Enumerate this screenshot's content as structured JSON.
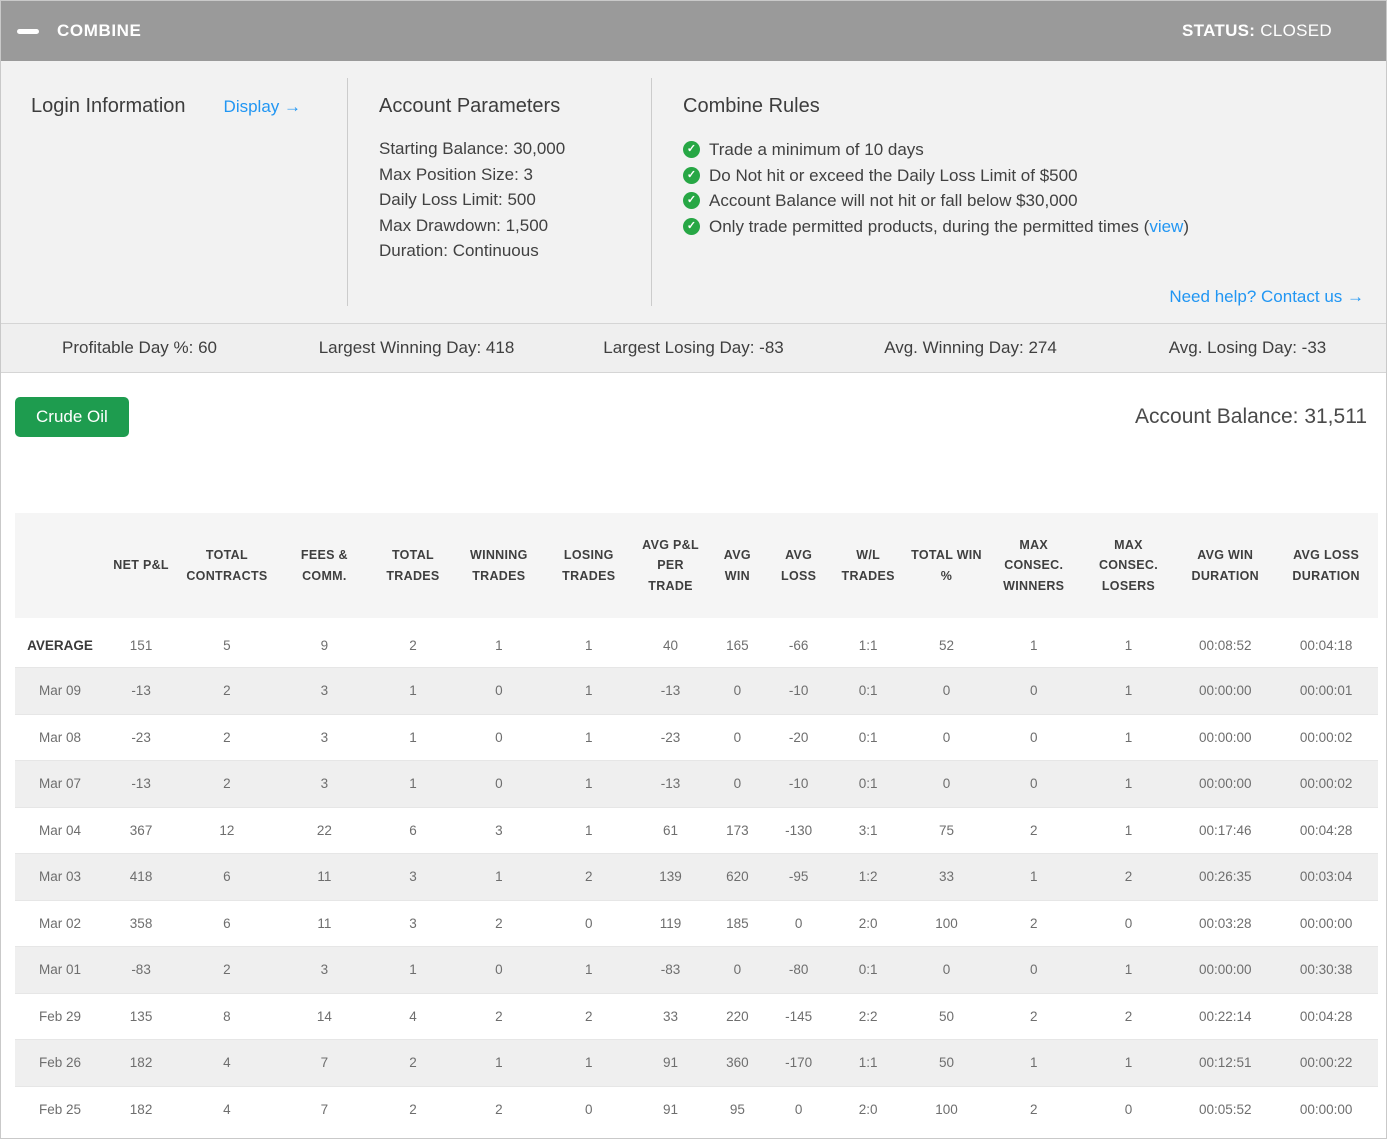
{
  "header": {
    "title": "COMBINE",
    "status_label": "STATUS:",
    "status_value": " CLOSED"
  },
  "login": {
    "title": "Login Information",
    "display_link": "Display →"
  },
  "account_parameters": {
    "title": "Account Parameters",
    "items": [
      "Starting Balance: 30,000",
      "Max Position Size: 3",
      "Daily Loss Limit: 500",
      "Max Drawdown: 1,500",
      "Duration: Continuous"
    ]
  },
  "combine_rules": {
    "title": "Combine Rules",
    "rules": [
      {
        "text": "Trade a minimum of 10 days"
      },
      {
        "text": "Do Not hit or exceed the Daily Loss Limit of $500"
      },
      {
        "text": "Account Balance will not hit or fall below $30,000"
      },
      {
        "text": "Only trade permitted products, during the permitted times (",
        "link": "view",
        "suffix": ")"
      }
    ]
  },
  "help_link": "Need help? Contact us →",
  "stats": [
    "Profitable Day %: 60",
    "Largest Winning Day: 418",
    "Largest Losing Day: -83",
    "Avg. Winning Day: 274",
    "Avg. Losing Day: -33"
  ],
  "instrument_button": "Crude Oil",
  "account_balance": {
    "label": "Account Balance: ",
    "value": "31,511"
  },
  "colors": {
    "header_gray": "#9a9a9a",
    "link_blue": "#2196f3",
    "check_green": "#27a745",
    "button_green": "#1e9c4f"
  },
  "table": {
    "columns": [
      "",
      "NET P&L",
      "TOTAL CONTRACTS",
      "FEES & COMM.",
      "TOTAL TRADES",
      "WINNING TRADES",
      "LOSING TRADES",
      "AVG P&L PER TRADE",
      "AVG WIN",
      "AVG LOSS",
      "W/L TRADES",
      "TOTAL WIN %",
      "MAX CONSEC. WINNERS",
      "MAX CONSEC. LOSERS",
      "AVG WIN DURATION",
      "AVG LOSS DURATION"
    ],
    "rows": [
      {
        "label": "AVERAGE",
        "bold": true,
        "values": [
          "151",
          "5",
          "9",
          "2",
          "1",
          "1",
          "40",
          "165",
          "-66",
          "1:1",
          "52",
          "1",
          "1",
          "00:08:52",
          "00:04:18"
        ]
      },
      {
        "label": "Mar 09",
        "values": [
          "-13",
          "2",
          "3",
          "1",
          "0",
          "1",
          "-13",
          "0",
          "-10",
          "0:1",
          "0",
          "0",
          "1",
          "00:00:00",
          "00:00:01"
        ]
      },
      {
        "label": "Mar 08",
        "values": [
          "-23",
          "2",
          "3",
          "1",
          "0",
          "1",
          "-23",
          "0",
          "-20",
          "0:1",
          "0",
          "0",
          "1",
          "00:00:00",
          "00:00:02"
        ]
      },
      {
        "label": "Mar 07",
        "values": [
          "-13",
          "2",
          "3",
          "1",
          "0",
          "1",
          "-13",
          "0",
          "-10",
          "0:1",
          "0",
          "0",
          "1",
          "00:00:00",
          "00:00:02"
        ]
      },
      {
        "label": "Mar 04",
        "values": [
          "367",
          "12",
          "22",
          "6",
          "3",
          "1",
          "61",
          "173",
          "-130",
          "3:1",
          "75",
          "2",
          "1",
          "00:17:46",
          "00:04:28"
        ]
      },
      {
        "label": "Mar 03",
        "values": [
          "418",
          "6",
          "11",
          "3",
          "1",
          "2",
          "139",
          "620",
          "-95",
          "1:2",
          "33",
          "1",
          "2",
          "00:26:35",
          "00:03:04"
        ]
      },
      {
        "label": "Mar 02",
        "values": [
          "358",
          "6",
          "11",
          "3",
          "2",
          "0",
          "119",
          "185",
          "0",
          "2:0",
          "100",
          "2",
          "0",
          "00:03:28",
          "00:00:00"
        ]
      },
      {
        "label": "Mar 01",
        "values": [
          "-83",
          "2",
          "3",
          "1",
          "0",
          "1",
          "-83",
          "0",
          "-80",
          "0:1",
          "0",
          "0",
          "1",
          "00:00:00",
          "00:30:38"
        ]
      },
      {
        "label": "Feb 29",
        "values": [
          "135",
          "8",
          "14",
          "4",
          "2",
          "2",
          "33",
          "220",
          "-145",
          "2:2",
          "50",
          "2",
          "2",
          "00:22:14",
          "00:04:28"
        ]
      },
      {
        "label": "Feb 26",
        "values": [
          "182",
          "4",
          "7",
          "2",
          "1",
          "1",
          "91",
          "360",
          "-170",
          "1:1",
          "50",
          "1",
          "1",
          "00:12:51",
          "00:00:22"
        ]
      },
      {
        "label": "Feb 25",
        "values": [
          "182",
          "4",
          "7",
          "2",
          "2",
          "0",
          "91",
          "95",
          "0",
          "2:0",
          "100",
          "2",
          "0",
          "00:05:52",
          "00:00:00"
        ]
      }
    ]
  }
}
